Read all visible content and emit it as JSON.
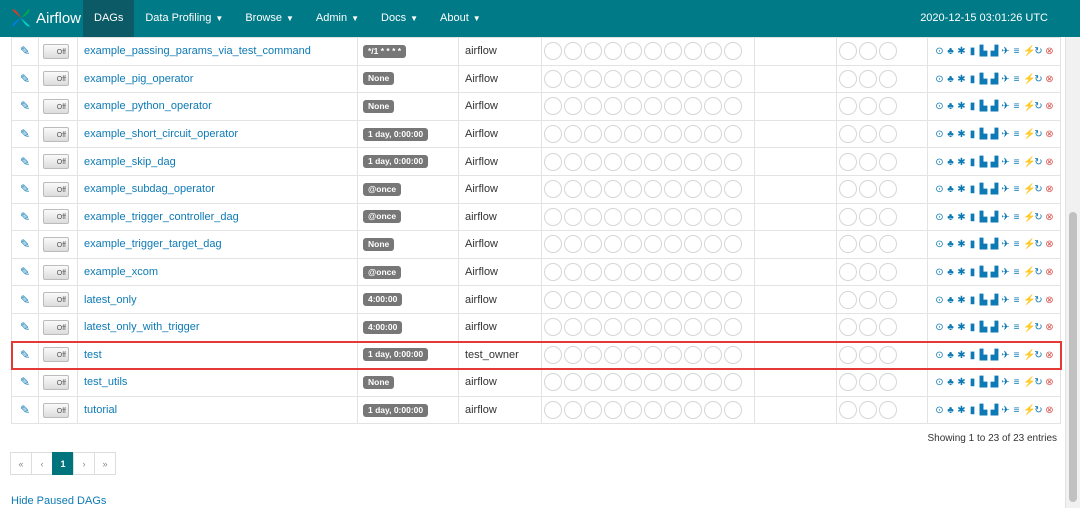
{
  "navbar": {
    "brand": "Airflow",
    "items": [
      {
        "label": "DAGs",
        "caret": false,
        "active": true
      },
      {
        "label": "Data Profiling",
        "caret": true
      },
      {
        "label": "Browse",
        "caret": true
      },
      {
        "label": "Admin",
        "caret": true
      },
      {
        "label": "Docs",
        "caret": true
      },
      {
        "label": "About",
        "caret": true
      }
    ],
    "clock": "2020-12-15 03:01:26 UTC"
  },
  "dags": [
    {
      "name": "example_passing_params_via_test_command",
      "schedule": "*/1 * * * *",
      "owner": "airflow",
      "toggle": "Off"
    },
    {
      "name": "example_pig_operator",
      "schedule": "None",
      "owner": "Airflow",
      "toggle": "Off"
    },
    {
      "name": "example_python_operator",
      "schedule": "None",
      "owner": "Airflow",
      "toggle": "Off"
    },
    {
      "name": "example_short_circuit_operator",
      "schedule": "1 day, 0:00:00",
      "owner": "Airflow",
      "toggle": "Off"
    },
    {
      "name": "example_skip_dag",
      "schedule": "1 day, 0:00:00",
      "owner": "Airflow",
      "toggle": "Off"
    },
    {
      "name": "example_subdag_operator",
      "schedule": "@once",
      "owner": "Airflow",
      "toggle": "Off"
    },
    {
      "name": "example_trigger_controller_dag",
      "schedule": "@once",
      "owner": "airflow",
      "toggle": "Off"
    },
    {
      "name": "example_trigger_target_dag",
      "schedule": "None",
      "owner": "Airflow",
      "toggle": "Off"
    },
    {
      "name": "example_xcom",
      "schedule": "@once",
      "owner": "Airflow",
      "toggle": "Off"
    },
    {
      "name": "latest_only",
      "schedule": "4:00:00",
      "owner": "airflow",
      "toggle": "Off"
    },
    {
      "name": "latest_only_with_trigger",
      "schedule": "4:00:00",
      "owner": "airflow",
      "toggle": "Off"
    },
    {
      "name": "test",
      "schedule": "1 day, 0:00:00",
      "owner": "test_owner",
      "toggle": "Off"
    },
    {
      "name": "test_utils",
      "schedule": "None",
      "owner": "airflow",
      "toggle": "Off"
    },
    {
      "name": "tutorial",
      "schedule": "1 day, 0:00:00",
      "owner": "airflow",
      "toggle": "Off"
    }
  ],
  "link_icons": [
    "trigger-dag-icon",
    "tree-view-icon",
    "graph-view-icon",
    "duration-chart-icon",
    "task-tries-icon",
    "landing-times-icon",
    "gantt-icon",
    "code-view-icon",
    "logs-icon",
    "refresh-icon",
    "delete-dag-icon"
  ],
  "run_state_circles": 10,
  "recent_task_circles": 3,
  "footer": {
    "entries": "Showing 1 to 23 of 23 entries",
    "pagination": [
      "«",
      "‹",
      "1",
      "›",
      "»"
    ],
    "active_page": "1",
    "hide_paused": "Hide Paused DAGs"
  },
  "colors": {
    "navbar": "#007a87",
    "link": "#0d7ab5",
    "highlight": "#e53935",
    "badge": "#777777"
  }
}
